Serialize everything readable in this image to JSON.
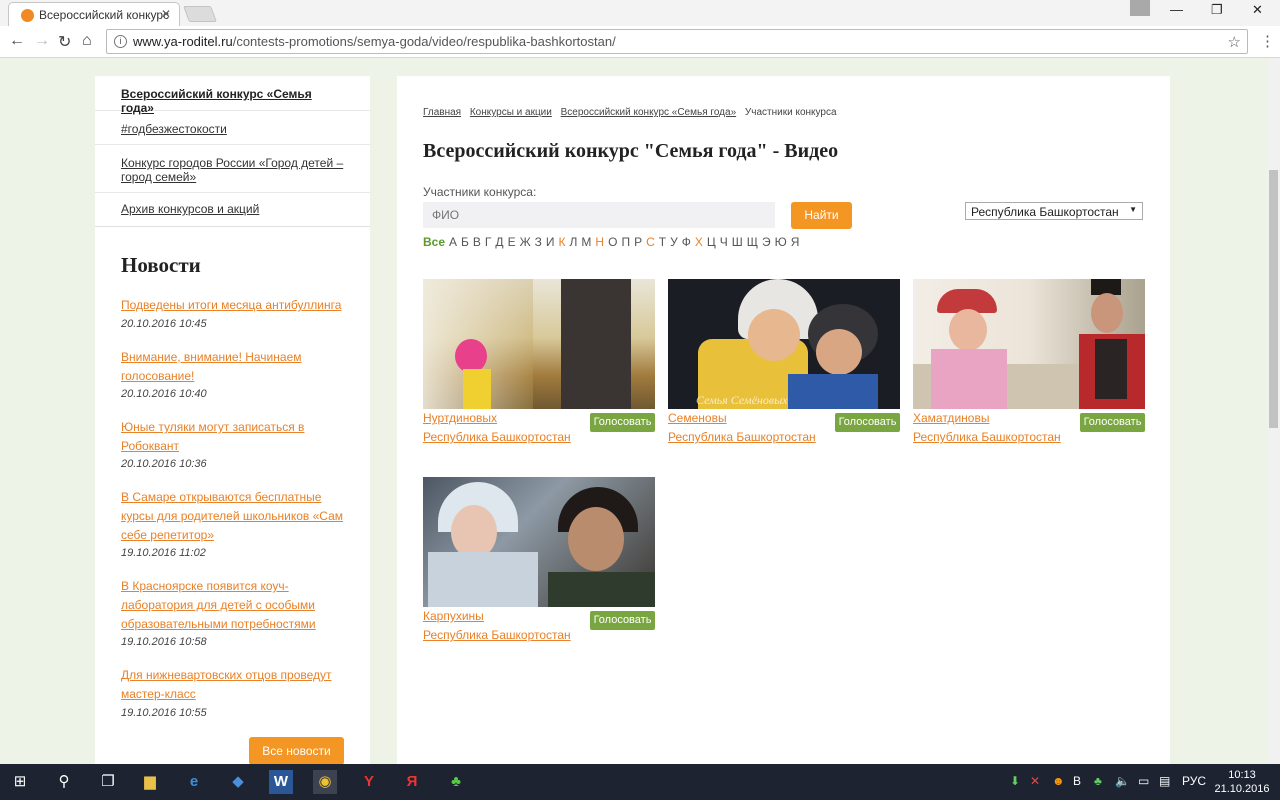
{
  "browser": {
    "tab_title": "Всероссийский конкурс",
    "url_host": "www.ya-roditel.ru",
    "url_path": "/contests-promotions/semya-goda/video/respublika-bashkortostan/"
  },
  "sidebar": {
    "items": [
      {
        "label": "Всероссийский конкурс «Семья года»"
      },
      {
        "label": "#годбезжестокости"
      },
      {
        "label": "Конкурс городов России «Город детей – город семей»"
      },
      {
        "label": "Архив конкурсов и акций"
      }
    ],
    "news_heading": "Новости",
    "news": [
      {
        "title": "Подведены итоги месяца антибуллинга",
        "date": "20.10.2016 10:45"
      },
      {
        "title": "Внимание, внимание! Начинаем голосование!",
        "date": "20.10.2016 10:40"
      },
      {
        "title": "Юные туляки могут записаться в Робоквант",
        "date": "20.10.2016 10:36"
      },
      {
        "title": "В Самаре открываются бесплатные курсы для родителей школьников «Сам себе репетитор»",
        "date": "19.10.2016 11:02"
      },
      {
        "title": "В Красноярске появится коуч-лаборатория для детей с особыми образовательными потребностями",
        "date": "19.10.2016 10:58"
      },
      {
        "title": "Для нижневартовских отцов проведут мастер-класс",
        "date": "19.10.2016 10:55"
      }
    ],
    "all_news_label": "Все новости"
  },
  "main": {
    "breadcrumbs": [
      "Главная",
      "Конкурсы и акции",
      "Всероссийский конкурс «Семья года»"
    ],
    "breadcrumb_current": "Участники конкурса",
    "title": "Всероссийский конкурс \"Семья года\" - Видео",
    "participants_label": "Участники конкурса:",
    "search_placeholder": "ФИО",
    "find_label": "Найти",
    "region_selected": "Республика Башкортостан",
    "alphabet": [
      {
        "l": "Все",
        "c": "#5a9a2a"
      },
      {
        "l": "А",
        "c": "#555"
      },
      {
        "l": "Б",
        "c": "#555"
      },
      {
        "l": "В",
        "c": "#555"
      },
      {
        "l": "Г",
        "c": "#555"
      },
      {
        "l": "Д",
        "c": "#555"
      },
      {
        "l": "Е",
        "c": "#555"
      },
      {
        "l": "Ж",
        "c": "#555"
      },
      {
        "l": "З",
        "c": "#555"
      },
      {
        "l": "И",
        "c": "#555"
      },
      {
        "l": "К",
        "c": "#e88127"
      },
      {
        "l": "Л",
        "c": "#555"
      },
      {
        "l": "М",
        "c": "#555"
      },
      {
        "l": "Н",
        "c": "#e88127"
      },
      {
        "l": "О",
        "c": "#555"
      },
      {
        "l": "П",
        "c": "#555"
      },
      {
        "l": "Р",
        "c": "#555"
      },
      {
        "l": "С",
        "c": "#e88127"
      },
      {
        "l": "Т",
        "c": "#555"
      },
      {
        "l": "У",
        "c": "#555"
      },
      {
        "l": "Ф",
        "c": "#555"
      },
      {
        "l": "Х",
        "c": "#e88127"
      },
      {
        "l": "Ц",
        "c": "#555"
      },
      {
        "l": "Ч",
        "c": "#555"
      },
      {
        "l": "Ш",
        "c": "#555"
      },
      {
        "l": "Щ",
        "c": "#555"
      },
      {
        "l": "Э",
        "c": "#555"
      },
      {
        "l": "Ю",
        "c": "#555"
      },
      {
        "l": "Я",
        "c": "#555"
      }
    ],
    "cards": [
      {
        "name": "Нуртдиновых",
        "region": "Республика Башкортостан",
        "vote": "Голосовать"
      },
      {
        "name": "Семеновы",
        "region": "Республика Башкортостан",
        "vote": "Голосовать",
        "watermark": "Семья Семёновых"
      },
      {
        "name": "Хаматдиновы",
        "region": "Республика Башкортостан",
        "vote": "Голосовать"
      },
      {
        "name": "Карпухины",
        "region": "Республика Башкортостан",
        "vote": "Голосовать"
      }
    ]
  },
  "taskbar": {
    "lang": "РУС",
    "time": "10:13",
    "date": "21.10.2016"
  },
  "colors": {
    "accent_orange": "#f39624",
    "link_orange": "#e88127",
    "vote_green": "#7aa642",
    "page_bg": "#eef3e8"
  }
}
